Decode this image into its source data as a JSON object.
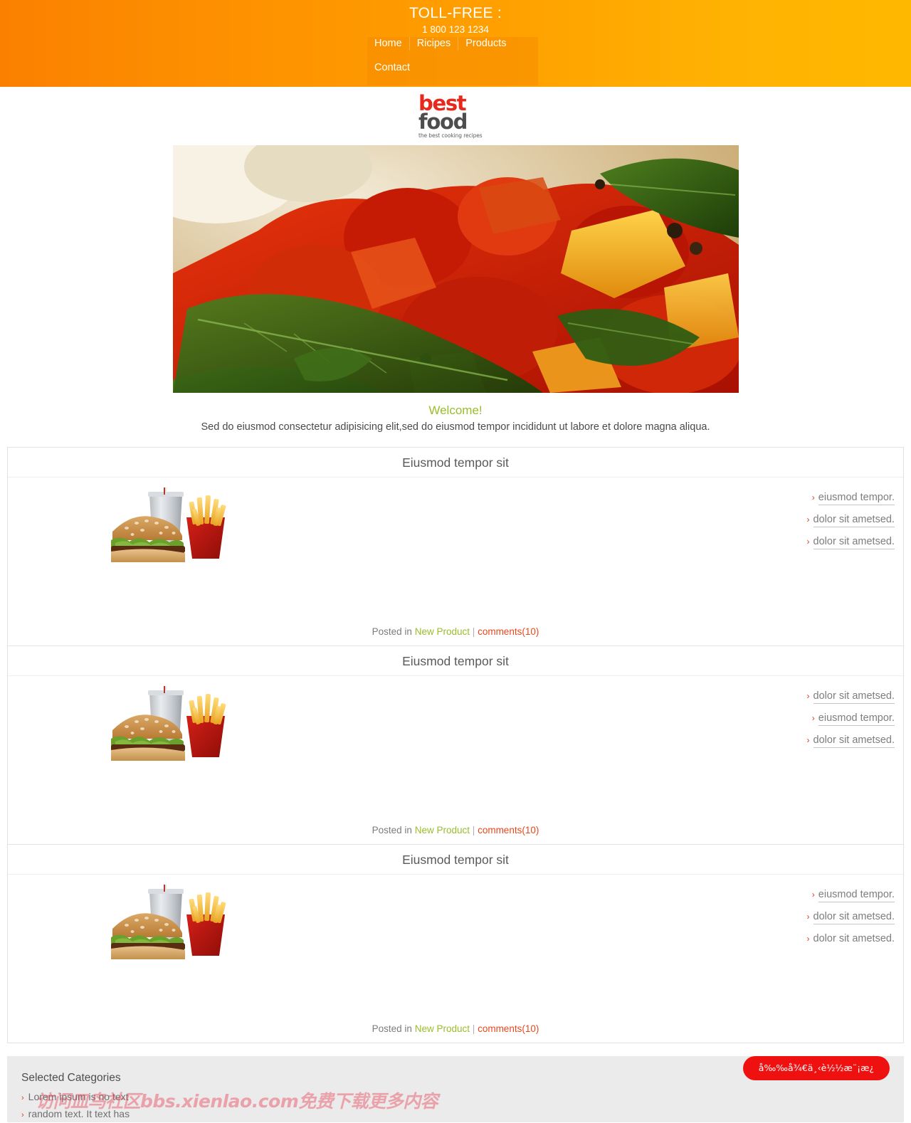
{
  "header": {
    "tollfree_label": "TOLL-FREE :",
    "phone": "1 800 123 1234",
    "nav": [
      {
        "label": "Home"
      },
      {
        "label": "Ricipes"
      },
      {
        "label": "Products"
      },
      {
        "label": "Contact"
      }
    ]
  },
  "logo": {
    "line1": "best",
    "line2": "food",
    "tagline": "the best cooking recipes"
  },
  "hero": {
    "alt": "spicy potato curry with bay leaves"
  },
  "welcome": {
    "title": "Welcome!",
    "subtitle": "Sed do eiusmod consectetur adipisicing elit,sed do eiusmod tempor incididunt ut labore et dolore magna aliqua."
  },
  "articles": [
    {
      "title": "Eiusmod tempor sit",
      "thumb_alt": "burger fries and drink",
      "links": [
        {
          "label": "eiusmod tempor.",
          "underline": true
        },
        {
          "label": "dolor sit ametsed.",
          "underline": true
        },
        {
          "label": "dolor sit ametsed.",
          "underline": true
        }
      ],
      "meta": {
        "posted_in": "Posted in",
        "category": "New Product",
        "separator": "|",
        "comments": "comments(10)"
      }
    },
    {
      "title": "Eiusmod tempor sit",
      "thumb_alt": "burger fries and drink",
      "links": [
        {
          "label": "dolor sit ametsed.",
          "underline": true
        },
        {
          "label": "eiusmod tempor.",
          "underline": true
        },
        {
          "label": "dolor sit ametsed.",
          "underline": true
        }
      ],
      "meta": {
        "posted_in": "Posted in",
        "category": "New Product",
        "separator": "|",
        "comments": "comments(10)"
      }
    },
    {
      "title": "Eiusmod tempor sit",
      "thumb_alt": "burger fries and drink",
      "links": [
        {
          "label": "eiusmod tempor.",
          "underline": true
        },
        {
          "label": "dolor sit ametsed.",
          "underline": true
        },
        {
          "label": "dolor sit ametsed.",
          "underline": false
        }
      ],
      "meta": {
        "posted_in": "Posted in",
        "category": "New Product",
        "separator": "|",
        "comments": "comments(10)"
      }
    }
  ],
  "footer": {
    "title": "Selected Categories",
    "items": [
      {
        "label": "Lorem ipsum is no text"
      },
      {
        "label": "random text. It text has"
      }
    ]
  },
  "watermark": {
    "text": "访问皿鸟社区bbs.xienlao.com免费下载更多内容"
  },
  "badge": {
    "text": "å‰‰å¾€ä¸‹è½½æ¨¡æ¿"
  },
  "colors": {
    "header_gradient_start": "#fb8000",
    "header_gradient_end": "#ffb800",
    "logo_red": "#e8281c",
    "logo_gray": "#4d4d4d",
    "accent_green": "#9bbc2b",
    "accent_red": "#e8471d",
    "chevron_red": "#d93d16",
    "badge_red": "#ef1010",
    "footer_bg": "#ebebeb",
    "border_gray": "#e2e2e2"
  }
}
